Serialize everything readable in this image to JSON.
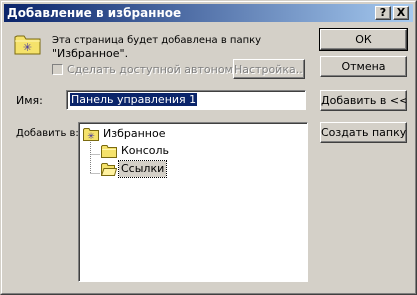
{
  "window": {
    "title": "Добавление в избранное"
  },
  "caption_buttons": {
    "help": "?",
    "close": "X"
  },
  "info": {
    "message_line1": "Эта страница будет добавлена в папку",
    "message_line2": "\"Избранное\"."
  },
  "offline": {
    "label": "Сделать доступной автономно",
    "checked": false,
    "enabled": false
  },
  "buttons": {
    "ok": "ОК",
    "cancel": "Отмена",
    "customize": "Настройка...",
    "add_to": "Добавить в <<",
    "new_folder": "Создать папку..."
  },
  "name_field": {
    "label": "Имя:",
    "value": "Панель управления 1"
  },
  "create_in": {
    "label": "Добавить в:"
  },
  "folder_tree": {
    "items": [
      {
        "label": "Избранное",
        "icon": "favorites-star-folder-icon",
        "level": 0
      },
      {
        "label": "Консоль",
        "icon": "folder-icon",
        "level": 1
      },
      {
        "label": "Ссылки",
        "icon": "folder-icon",
        "level": 1,
        "selected": true
      }
    ]
  },
  "colors": {
    "title_gradient_start": "#0a246a",
    "title_gradient_end": "#a6caf0",
    "face": "#d4d0c8",
    "selection": "#0a246a",
    "folder_yellow": "#f5e26b"
  }
}
